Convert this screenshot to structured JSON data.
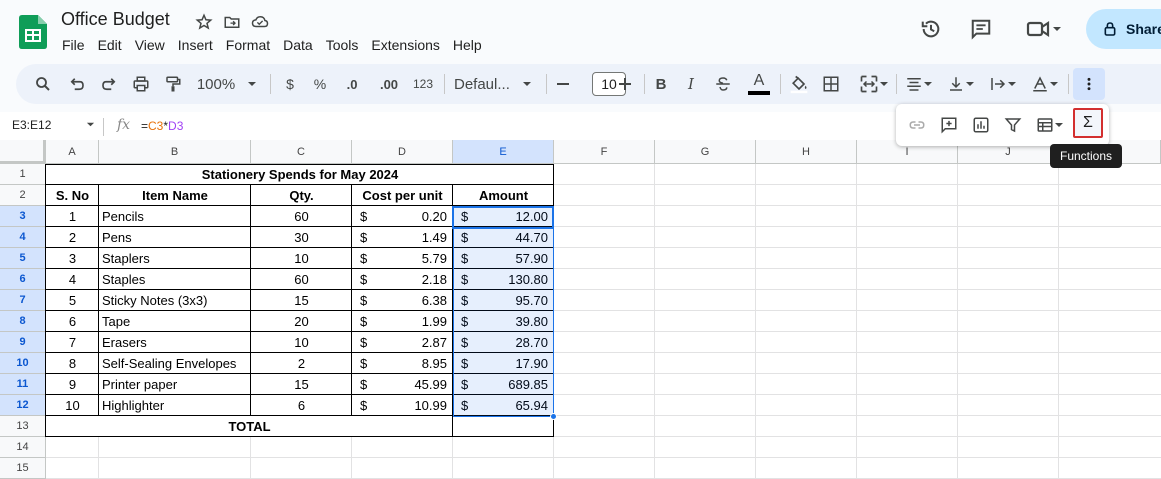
{
  "app": {
    "doc_title": "Office Budget",
    "menu": [
      "File",
      "Edit",
      "View",
      "Insert",
      "Format",
      "Data",
      "Tools",
      "Extensions",
      "Help"
    ],
    "share_label": "Share"
  },
  "toolbar": {
    "zoom": "100%",
    "currency": "$",
    "percent": "%",
    "dec_decrease": ".0",
    "dec_increase": ".00",
    "number_format": "123",
    "font": "Defaul...",
    "font_size": "10",
    "bold": "B",
    "italic": "I",
    "text_color": "A"
  },
  "formula_bar": {
    "name_box": "E3:E12",
    "fx": "fx",
    "formula_eq": "=",
    "formula_ref1": "C3",
    "formula_op": "*",
    "formula_ref2": "D3"
  },
  "popup": {
    "functions_symbol": "Σ",
    "tooltip": "Functions"
  },
  "grid": {
    "columns": [
      "A",
      "B",
      "C",
      "D",
      "E",
      "F",
      "G",
      "H",
      "I",
      "J"
    ],
    "rows": [
      "1",
      "2",
      "3",
      "4",
      "5",
      "6",
      "7",
      "8",
      "9",
      "10",
      "11",
      "12",
      "13",
      "14",
      "15"
    ],
    "title": "Stationery Spends for May 2024",
    "headers": [
      "S. No",
      "Item Name",
      "Qty.",
      "Cost per unit",
      "Amount"
    ],
    "items": [
      {
        "sno": "1",
        "name": "Pencils",
        "qty": "60",
        "cost": "0.20",
        "amount": "12.00"
      },
      {
        "sno": "2",
        "name": "Pens",
        "qty": "30",
        "cost": "1.49",
        "amount": "44.70"
      },
      {
        "sno": "3",
        "name": "Staplers",
        "qty": "10",
        "cost": "5.79",
        "amount": "57.90"
      },
      {
        "sno": "4",
        "name": "Staples",
        "qty": "60",
        "cost": "2.18",
        "amount": "130.80"
      },
      {
        "sno": "5",
        "name": "Sticky Notes (3x3)",
        "qty": "15",
        "cost": "6.38",
        "amount": "95.70"
      },
      {
        "sno": "6",
        "name": "Tape",
        "qty": "20",
        "cost": "1.99",
        "amount": "39.80"
      },
      {
        "sno": "7",
        "name": "Erasers",
        "qty": "10",
        "cost": "2.87",
        "amount": "28.70"
      },
      {
        "sno": "8",
        "name": "Self-Sealing Envelopes",
        "qty": "2",
        "cost": "8.95",
        "amount": "17.90"
      },
      {
        "sno": "9",
        "name": "Printer paper",
        "qty": "15",
        "cost": "45.99",
        "amount": "689.85"
      },
      {
        "sno": "10",
        "name": "Highlighter",
        "qty": "6",
        "cost": "10.99",
        "amount": "65.94"
      }
    ],
    "currency_symbol": "$",
    "total_label": "TOTAL"
  },
  "colors": {
    "accent": "#1a73e8",
    "selection": "#d3e3fd",
    "highlight_border": "#d32f2f",
    "ref1_color": "#e8710a",
    "ref2_color": "#a142f4"
  }
}
